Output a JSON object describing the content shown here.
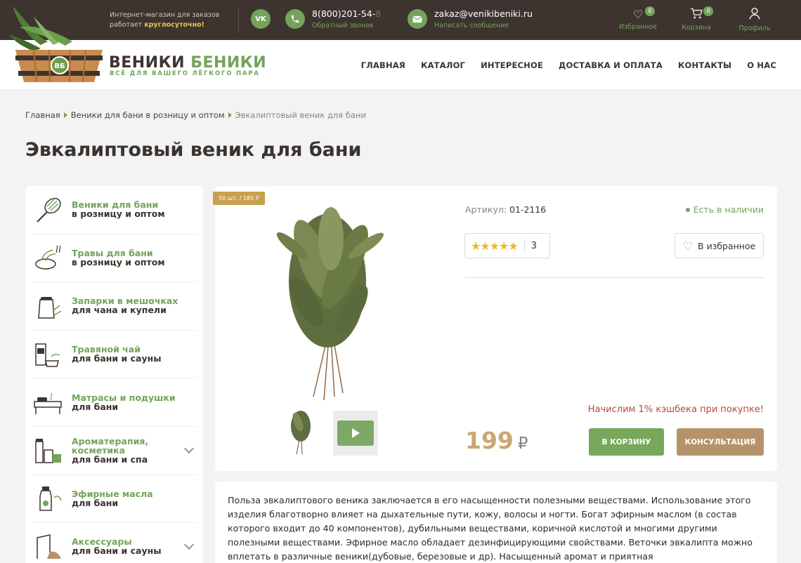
{
  "topbar": {
    "hours_line1": "Интернет-магазин для заказов",
    "hours_line2": "работает",
    "hours_bold": "круглосуточно!",
    "vk_label": "VK",
    "phone_visible": "8(800)201-54-",
    "phone_faded": "8",
    "phone_sub": "Обратный звонок",
    "email": "zakaz@venikibeniki.ru",
    "email_sub": "Написать сообщение",
    "favorites_label": "Избранное",
    "favorites_count": "0",
    "cart_label": "Корзина",
    "cart_count": "0",
    "profile_label": "Профиль"
  },
  "header": {
    "brand_part1": "ВЕНИКИ",
    "brand_part2": "БЕНИКИ",
    "slogan": "ВСЁ ДЛЯ ВАШЕГО ЛЁГКОГО ПАРА",
    "logo_badge": "ВБ",
    "nav": [
      "ГЛАВНАЯ",
      "КАТАЛОГ",
      "ИНТЕРЕСНОЕ",
      "ДОСТАВКА И ОПЛАТА",
      "КОНТАКТЫ",
      "О НАС"
    ]
  },
  "breadcrumb": {
    "items": [
      "Главная",
      "Веники для бани в розницу и оптом"
    ],
    "current": "Эвкалиптовый веник для бани"
  },
  "page_title": "Эвкалиптовый веник для бани",
  "sidebar": {
    "items": [
      {
        "line1": "Веники для бани",
        "line2": "в розницу и оптом",
        "icon": "broom-icon",
        "has_submenu": false
      },
      {
        "line1": "Травы для бани",
        "line2": "в розницу и оптом",
        "icon": "herbs-icon",
        "has_submenu": false
      },
      {
        "line1": "Запарки в мешочках",
        "line2": "для чана и купели",
        "icon": "bag-icon",
        "has_submenu": false
      },
      {
        "line1": "Травяной чай",
        "line2": "для бани и сауны",
        "icon": "tea-icon",
        "has_submenu": false
      },
      {
        "line1": "Матрасы и подушки",
        "line2": "для бани",
        "icon": "mattress-icon",
        "has_submenu": false
      },
      {
        "line1": "Ароматерапия, косметика",
        "line2": "для бани и спа",
        "icon": "cosmetics-icon",
        "has_submenu": true
      },
      {
        "line1": "Эфирные масла",
        "line2": "для бани",
        "icon": "oil-icon",
        "has_submenu": false
      },
      {
        "line1": "Аксессуары",
        "line2": "для бани и сауны",
        "icon": "accessories-icon",
        "has_submenu": true
      }
    ]
  },
  "product": {
    "tag": "50 шт. / 185 Р",
    "sku_label": "Артикул:",
    "sku_value": "01-2116",
    "stock": "Есть в наличии",
    "rating_stars": 5,
    "rating_stars_text": "★★★★★",
    "rating_count": "3",
    "favorite_button": "В избранное",
    "cashback": "Начислим 1% кэшбека при покупке!",
    "price": "199",
    "currency": "₽",
    "cart_button": "В КОРЗИНУ",
    "consult_button": "КОНСУЛЬТАЦИЯ"
  },
  "description": "Польза эвкалиптового веника заключается в его насыщенности полезными веществами. Использование этого изделия благотворно влияет на дыхательные пути, кожу, волосы и ногти. Богат эфирным маслом (в состав которого входит до 40 компонентов), дубильными веществами, коричной кислотой и многими другими полезными веществами. Эфирное масло обладает дезинфицирующими свойствами. Веточки эвкалипта можно вплетать в различные веники(дубовые, березовые и др). Насыщенный аромат и приятная",
  "colors": {
    "topbar_bg": "#3d3430",
    "accent_green": "#74a35a",
    "gold": "#c9a04d",
    "price": "#c9a776",
    "cashback_red": "#c0473a"
  }
}
